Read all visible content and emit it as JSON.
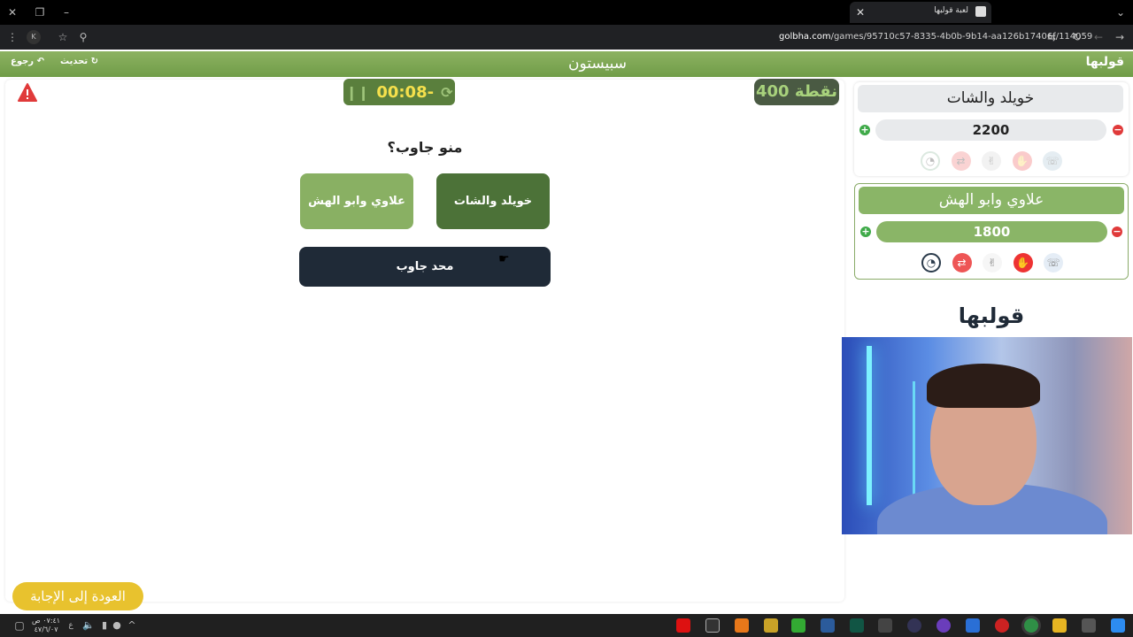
{
  "browser": {
    "tab_title": "لعبة قولبها",
    "url_host": "golbha.com",
    "url_path": "/games/95710c57-8335-4b0b-9b14-aa126b17406f/114059"
  },
  "header": {
    "title": "سبيستون",
    "refresh_label": "تحديث",
    "back_label": "رجوع",
    "logo": "قولبها"
  },
  "game": {
    "timer": "00:08-",
    "points": "400 نقطة",
    "question": "منو جاوب؟",
    "answers": {
      "team_a": "خويلد والشات",
      "team_b": "علاوي وابو الهش",
      "none": "محد جاوب"
    },
    "back_to_answer": "العودة إلى الإجابة"
  },
  "teams": [
    {
      "name": "خويلد والشات",
      "score": "2200",
      "active": false
    },
    {
      "name": "علاوي وابو الهش",
      "score": "1800",
      "active": true
    }
  ],
  "brand": "قولبها",
  "taskbar": {
    "time": "٠٧:٤١ ص",
    "date": "٤٧/٦/٠٧",
    "lang": "ع"
  },
  "colors": {
    "header_green": "#7aa552",
    "team_a_button": "#4c7238",
    "team_b_button": "#89b063",
    "none_button": "#1f2a37",
    "timer_text": "#f5e04c",
    "back_button": "#e8c22e"
  }
}
